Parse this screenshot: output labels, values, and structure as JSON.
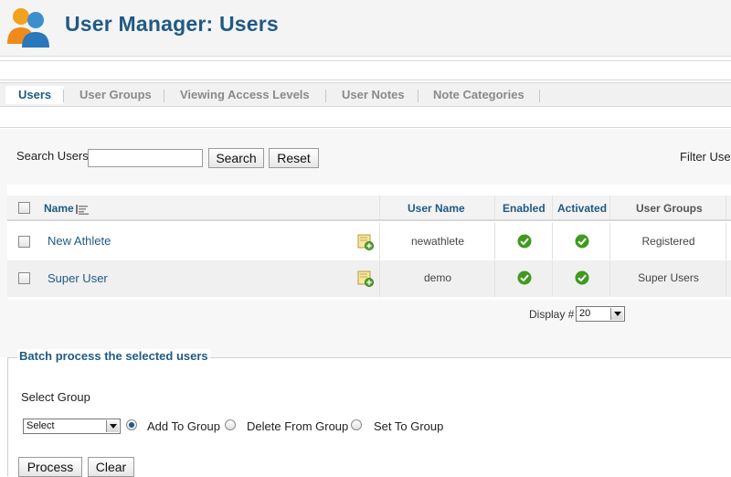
{
  "header": {
    "title": "User Manager: Users"
  },
  "tabs": [
    {
      "label": "Users",
      "active": true
    },
    {
      "label": "User Groups"
    },
    {
      "label": "Viewing Access Levels"
    },
    {
      "label": "User Notes"
    },
    {
      "label": "Note Categories"
    }
  ],
  "filter": {
    "search_label": "Search Users",
    "search_value": "",
    "search_button": "Search",
    "reset_button": "Reset",
    "filter_user_label": "Filter User"
  },
  "table": {
    "columns": [
      "Name",
      "User Name",
      "Enabled",
      "Activated",
      "User Groups"
    ],
    "rows": [
      {
        "name": "New Athlete",
        "username": "newathlete",
        "groups": "Registered"
      },
      {
        "name": "Super User",
        "username": "demo",
        "groups": "Super Users"
      }
    ]
  },
  "pagination": {
    "display_label": "Display #",
    "display_value": "20"
  },
  "batch": {
    "title": "Batch process the selected users",
    "select_group_label": "Select Group",
    "select_value": "Select",
    "radio_add": "Add To Group",
    "radio_delete": "Delete From Group",
    "radio_set": "Set To Group",
    "process_button": "Process",
    "clear_button": "Clear"
  },
  "colors": {
    "brand": "#1f5a85",
    "success": "#3f9a1f"
  }
}
